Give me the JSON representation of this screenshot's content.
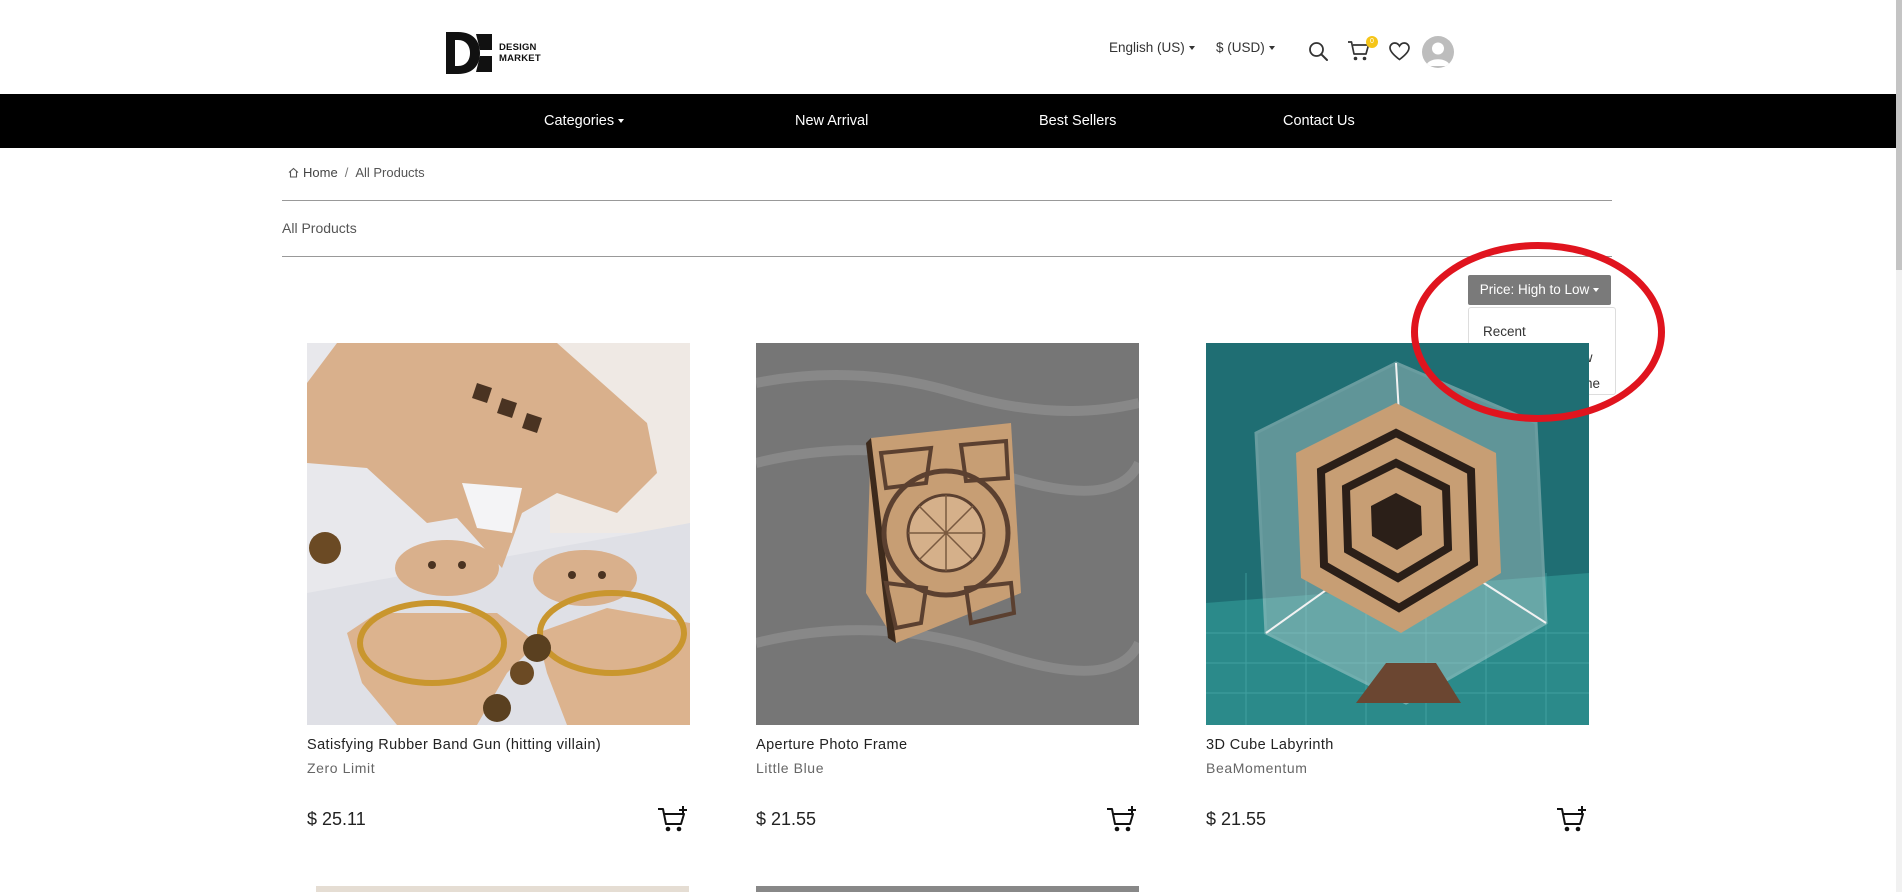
{
  "brand": {
    "line1": "DESIGN",
    "line2": "MARKET"
  },
  "header": {
    "language": "English (US)",
    "currency": "$ (USD)",
    "cart_count": "0"
  },
  "nav": {
    "categories": "Categories",
    "new_arrival": "New Arrival",
    "best_sellers": "Best Sellers",
    "contact_us": "Contact Us"
  },
  "breadcrumb": {
    "home": "Home",
    "current": "All Products"
  },
  "section_title": "All Products",
  "sort": {
    "selected": "Price: High to Low",
    "options": [
      "Recent",
      "Price: High to Low",
      "Price: Low to Highe"
    ]
  },
  "products": [
    {
      "name": "Satisfying Rubber Band Gun (hitting villain)",
      "shop": "Zero Limit",
      "price": "$ 25.11"
    },
    {
      "name": "Aperture Photo Frame",
      "shop": "Little Blue",
      "price": "$ 21.55"
    },
    {
      "name": "3D Cube Labyrinth",
      "shop": "BeaMomentum",
      "price": "$ 21.55"
    }
  ],
  "colors": {
    "navbar": "#000000",
    "sort_button": "#7a7a7a",
    "annotation": "#e0141e",
    "cart_badge": "#f5c518"
  },
  "icons": [
    "home-icon",
    "search-icon",
    "cart-icon",
    "heart-icon",
    "user-avatar-icon",
    "add-to-cart-icon",
    "caret-down-icon"
  ]
}
